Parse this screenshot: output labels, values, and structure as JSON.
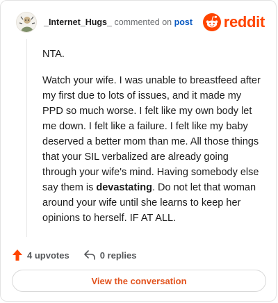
{
  "header": {
    "author": "_Internet_Hugs_",
    "commented_on": "commented on",
    "post_link": "post",
    "logo_text": "reddit"
  },
  "comment": {
    "paragraph_1": "NTA.",
    "paragraph_2_before": "Watch your wife. I was unable to breastfeed after my first due to lots of issues, and it made my PPD so much worse. I felt like my own body let me down. I felt like a failure. I felt like my baby deserved a better mom than me. All those things that your SIL verbalized are already going through your wife's mind. Having somebody else say them is ",
    "paragraph_2_bold": "devastating",
    "paragraph_2_after": ". Do not let that woman around your wife until she learns to keep her opinions to herself. IF AT ALL."
  },
  "actions": {
    "upvotes": "4 upvotes",
    "replies": "0 replies"
  },
  "view_button": "View the conversation",
  "colors": {
    "brand": "#ff4500",
    "link": "#0a5ac2",
    "button_text": "#e2541f"
  }
}
